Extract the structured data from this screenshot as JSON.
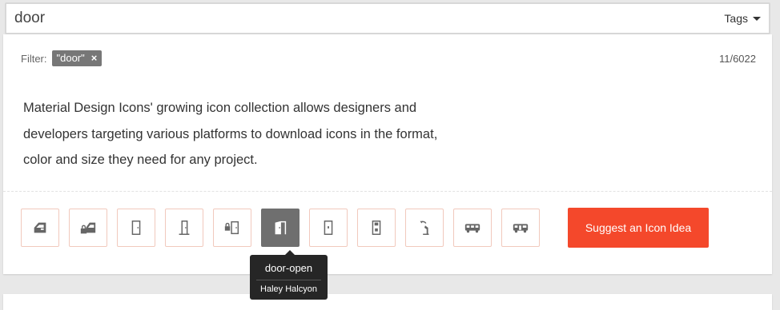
{
  "search": {
    "value": "door"
  },
  "tags_label": "Tags",
  "filter": {
    "label": "Filter:",
    "chip": "\"door\"",
    "chip_remove": "×"
  },
  "count": "11/6022",
  "description": [
    "Material Design Icons' growing icon collection allows designers and",
    "developers targeting various platforms to download icons in the format,",
    "color and size they need for any project."
  ],
  "icons": [
    {
      "name": "car-door-icon"
    },
    {
      "name": "car-door-lock-icon"
    },
    {
      "name": "door-closed-icon"
    },
    {
      "name": "door-open-outline-icon"
    },
    {
      "name": "door-closed-lock-icon"
    },
    {
      "name": "door-open-icon",
      "active": true
    },
    {
      "name": "door-sliding-icon"
    },
    {
      "name": "door-sliding-lock-icon"
    },
    {
      "name": "door-sliding-open-icon"
    },
    {
      "name": "bus-side-icon"
    },
    {
      "name": "bus-door-icon"
    }
  ],
  "suggest_label": "Suggest an Icon Idea",
  "tooltip": {
    "name": "door-open",
    "author": "Haley Halcyon"
  },
  "colors": {
    "accent": "#f4482b",
    "chip": "#777777",
    "tile_border": "#f1c9bd",
    "active_tile": "#6f6f6f"
  }
}
